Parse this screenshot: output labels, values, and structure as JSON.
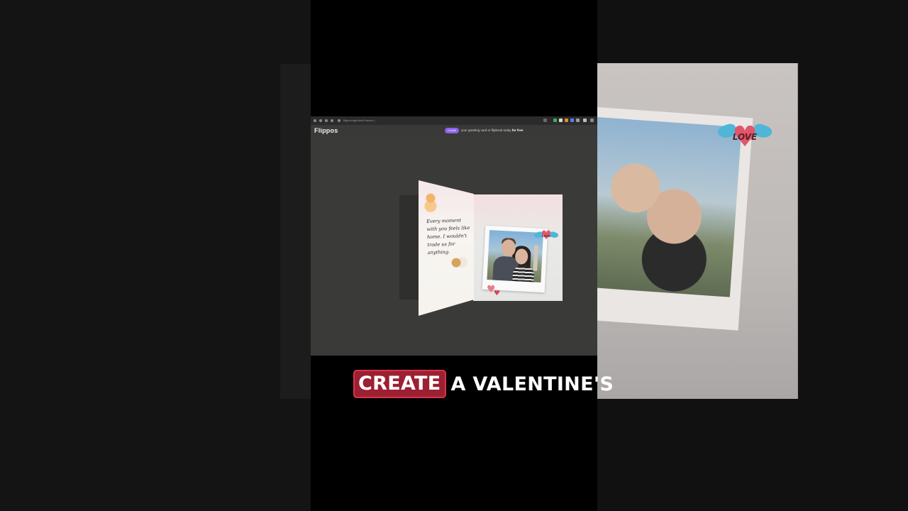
{
  "browser": {
    "url": "flippos.app/view?nouce=...",
    "brand": "Flippos",
    "create_label": "Create",
    "promo_text": "your greeting card or flipbook today",
    "promo_bold": "for free"
  },
  "card": {
    "message": "Every moment with you feels like home. I wouldn't trade us for anything.",
    "sticker_label": "LOVE"
  },
  "background_sticker_label": "LOVE",
  "caption": {
    "highlight": "CREATE",
    "rest": "A VALENTINE'S"
  },
  "colors": {
    "accent_purple": "#8a63e6",
    "caption_highlight": "#9b2032",
    "heart_pink": "#e0576b",
    "wing_blue": "#4fb6d8"
  }
}
